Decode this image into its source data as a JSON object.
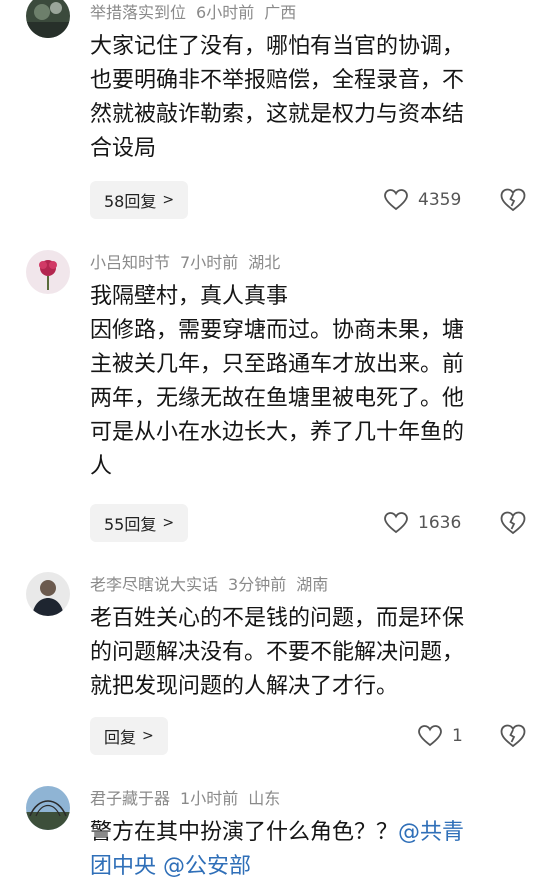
{
  "comments": [
    {
      "username": "举措落实到位",
      "time": "6小时前",
      "location": "广西",
      "lines": [
        "大家记住了没有，哪怕有当官的协调，",
        "也要明确非不举报赔偿，全程录音，不",
        "然就被敲诈勒索，这就是权力与资本结",
        "合设局"
      ],
      "reply_label": "58回复",
      "likes": "4359"
    },
    {
      "username": "小吕知时节",
      "time": "7小时前",
      "location": "湖北",
      "lines": [
        "我隔壁村，真人真事",
        "因修路，需要穿塘而过。协商未果，塘",
        "主被关几年，只至路通车才放出来。前",
        "两年，无缘无故在鱼塘里被电死了。他",
        "可是从小在水边长大，养了几十年鱼的",
        "人"
      ],
      "reply_label": "55回复",
      "likes": "1636"
    },
    {
      "username": "老李尽瞎说大实话",
      "time": "3分钟前",
      "location": "湖南",
      "lines": [
        "老百姓关心的不是钱的问题，而是环保",
        "的问题解决没有。不要不能解决问题，",
        "就把发现问题的人解决了才行。"
      ],
      "reply_label": "回复",
      "likes": "1"
    },
    {
      "username": "君子藏于器",
      "time": "1小时前",
      "location": "山东",
      "line1_text": "警方在其中扮演了什么角色？？",
      "mention1": "@共青",
      "mention2": "团中央",
      "mention3": "@公安部"
    }
  ],
  "icons": {
    "like": "heart-outline-icon",
    "dislike": "broken-heart-icon",
    "chevron": "chevron-right-icon"
  }
}
